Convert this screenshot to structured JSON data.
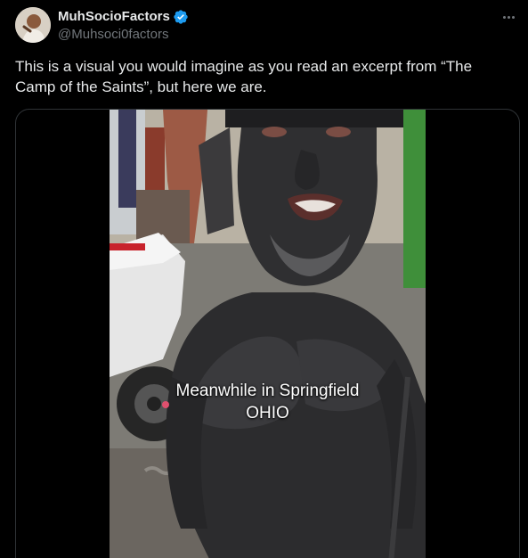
{
  "author": {
    "display_name": "MuhSocioFactors",
    "handle": "@Muhsoci0factors",
    "verified_color": "#1d9bf0",
    "avatar_icon": "profile-photo"
  },
  "more_icon": "more-horizontal-icon",
  "tweet": {
    "text": "This is a visual you would imagine as you read an excerpt from “The Camp of the Saints”, but here we are."
  },
  "media": {
    "type": "video",
    "caption_line1": "Meanwhile in Springfield",
    "caption_line2": "OHIO"
  },
  "colors": {
    "background": "#000000",
    "text_primary": "#e7e9ea",
    "text_secondary": "#71767b",
    "border": "#2f3336"
  }
}
